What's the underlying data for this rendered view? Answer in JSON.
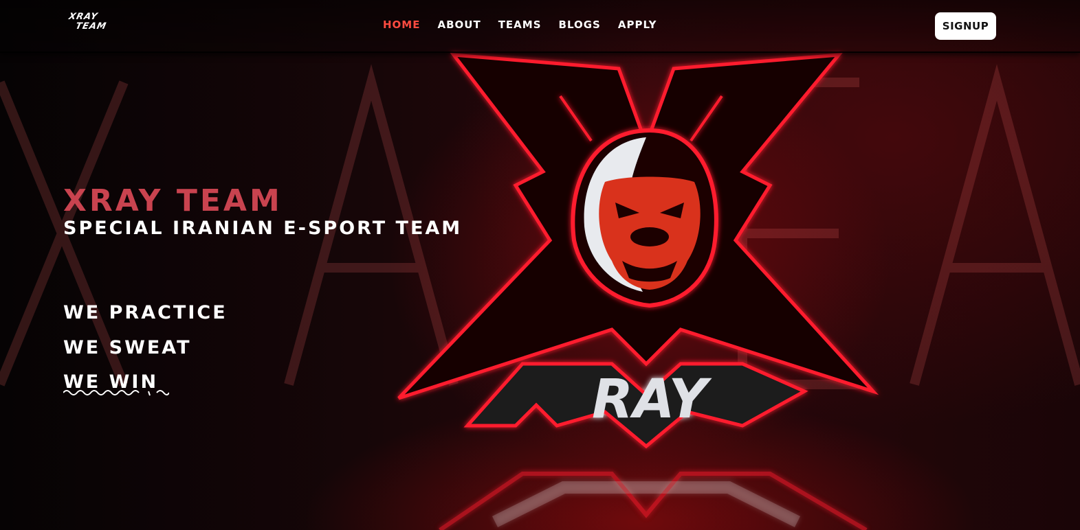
{
  "brand": {
    "logo_line_1": "XRAY",
    "logo_line_2": "TEAM"
  },
  "nav": {
    "items": [
      {
        "label": "HOME",
        "active": true
      },
      {
        "label": "ABOUT",
        "active": false
      },
      {
        "label": "TEAMS",
        "active": false
      },
      {
        "label": "BLOGS",
        "active": false
      },
      {
        "label": "APPLY",
        "active": false
      }
    ],
    "signup_label": "SIGNUP"
  },
  "hero": {
    "title": "XRAY TEAM",
    "subtitle": "SPECIAL IRANIAN E-SPORT TEAM",
    "mottos": [
      "WE PRACTICE",
      "WE SWEAT",
      "WE WIN"
    ]
  },
  "emblem": {
    "wordmark": "RAY"
  },
  "colors": {
    "accent": "#ff4b40",
    "title": "#c9434f",
    "neon_red": "#ff1f2e",
    "background": "#0a0406"
  }
}
